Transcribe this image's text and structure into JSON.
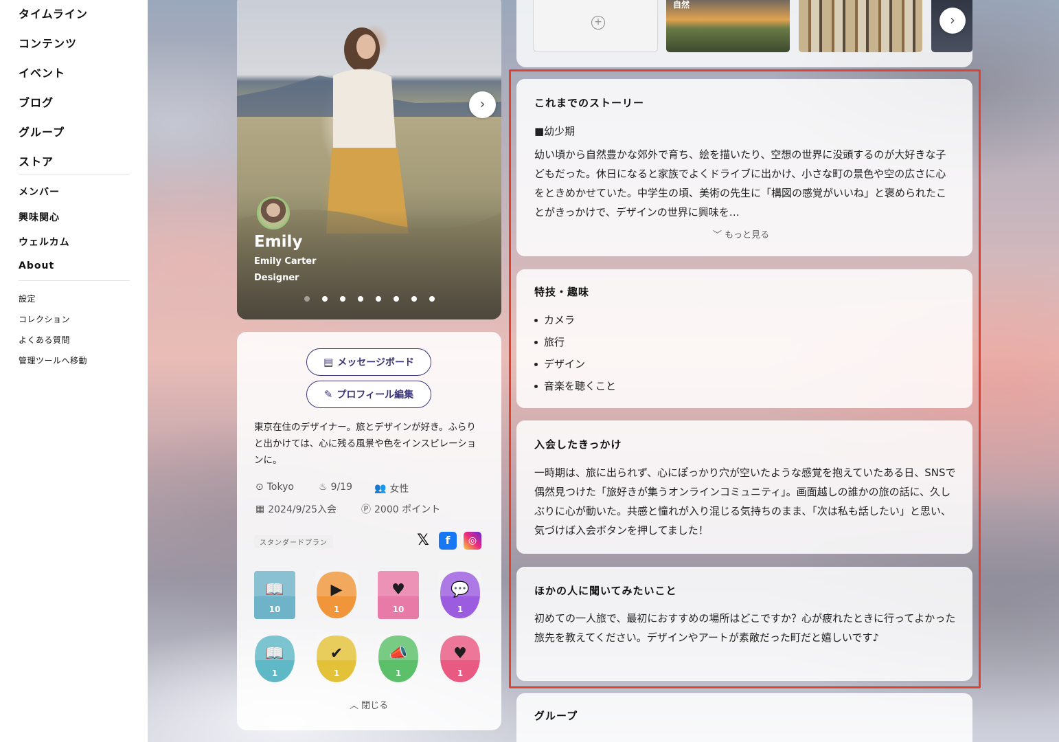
{
  "sidebar": {
    "main": [
      "タイムライン",
      "コンテンツ",
      "イベント",
      "ブログ",
      "グループ",
      "ストア"
    ],
    "community": [
      "メンバー",
      "興味関心",
      "ウェルカム",
      "About"
    ],
    "misc": [
      "設定",
      "コレクション",
      "よくある質問",
      "管理ツールへ移動"
    ]
  },
  "profile": {
    "name": "Emily",
    "full_name": "Emily Carter",
    "role": "Designer",
    "slides_total": 8,
    "slide_active": 1
  },
  "actions": {
    "message_board": "メッセージボード",
    "edit_profile": "プロフィール編集"
  },
  "bio": "東京在住のデザイナー。旅とデザインが好き。ふらりと出かけては、心に残る風景や色をインスピレーションに。",
  "meta": {
    "location": "Tokyo",
    "birthday": "9/19",
    "gender": "女性",
    "joined": "2024/9/25入会",
    "points": "2000 ポイント"
  },
  "plan": "スタンダードプラン",
  "badges": [
    {
      "icon": "book-icon",
      "count": "10",
      "color": "#6fb3c9"
    },
    {
      "icon": "video-calendar-icon",
      "count": "1",
      "color": "#f0953a"
    },
    {
      "icon": "heart-icon",
      "count": "10",
      "color": "#e87aa8"
    },
    {
      "icon": "chat-icon",
      "count": "1",
      "color": "#9b5ce0"
    },
    {
      "icon": "book-icon",
      "count": "1",
      "color": "#5fb8c6"
    },
    {
      "icon": "calendar-check-icon",
      "count": "1",
      "color": "#e3c23a"
    },
    {
      "icon": "megaphone-icon",
      "count": "1",
      "color": "#5cc06a"
    },
    {
      "icon": "heart-icon",
      "count": "1",
      "color": "#e85a82"
    }
  ],
  "close_label": "閉じる",
  "gallery": {
    "thumb_caption": "自然"
  },
  "sections": {
    "story": {
      "title": "これまでのストーリー",
      "sub": "■幼少期",
      "body": "幼い頃から自然豊かな郊外で育ち、絵を描いたり、空想の世界に没頭するのが大好きな子どもだった。休日になると家族でよくドライブに出かけ、小さな町の景色や空の広さに心をときめかせていた。中学生の頃、美術の先生に「構図の感覚がいいね」と褒められたことがきっかけで、デザインの世界に興味を…",
      "more": "もっと見る"
    },
    "hobbies": {
      "title": "特技・趣味",
      "items": [
        "カメラ",
        "旅行",
        "デザイン",
        "音楽を聴くこと"
      ]
    },
    "join": {
      "title": "入会したきっかけ",
      "body": "一時期は、旅に出られず、心にぽっかり穴が空いたような感覚を抱えていたある日、SNSで偶然見つけた「旅好きが集うオンラインコミュニティ」。画面越しの誰かの旅の話に、久しぶりに心が動いた。共感と憧れが入り混じる気持ちのまま、「次は私も話したい」と思い、気づけば入会ボタンを押してました！"
    },
    "ask": {
      "title": "ほかの人に聞いてみたいこと",
      "body": "初めての一人旅で、最初におすすめの場所はどこですか？心が疲れたときに行ってよかった旅先を教えてください。デザインやアートが素敵だった町だと嬉しいです♪"
    },
    "group": {
      "title": "グループ"
    }
  },
  "colors": {
    "accent": "#3a3577",
    "highlight_frame": "#e0402f"
  }
}
